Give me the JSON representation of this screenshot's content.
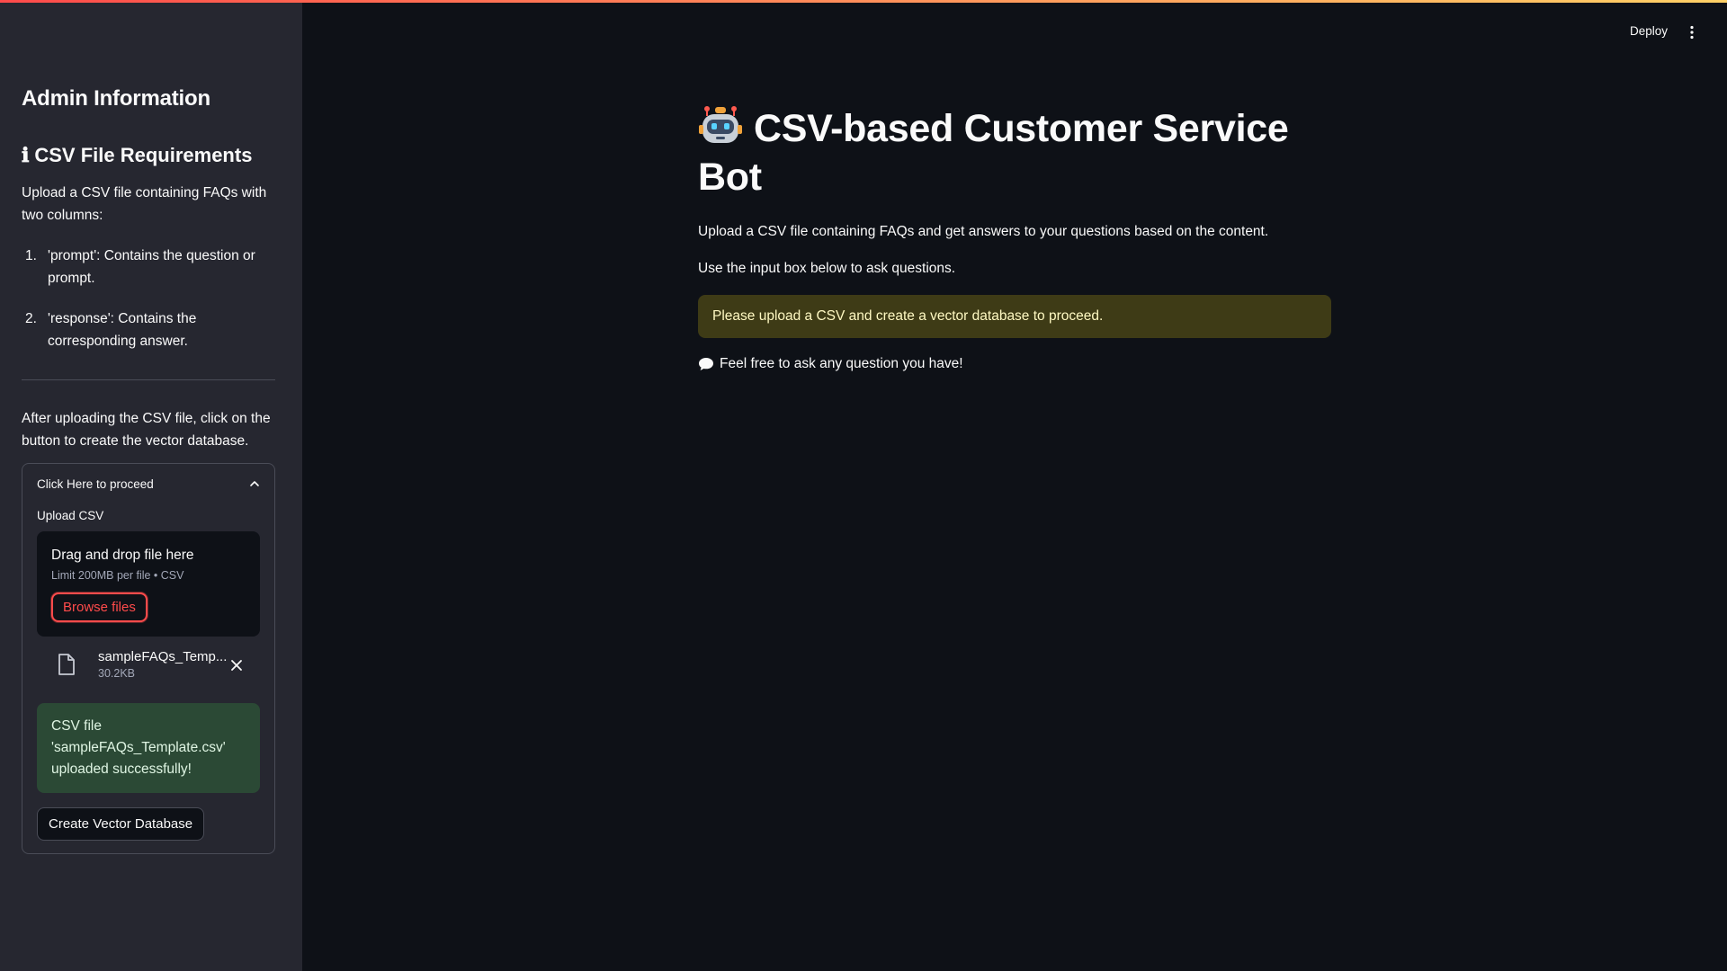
{
  "header": {
    "deploy_label": "Deploy",
    "menu_icon": "vertical-ellipsis-icon"
  },
  "sidebar": {
    "heading": "Admin Information",
    "req_icon_glyph": "ℹ",
    "req_heading": "CSV File Requirements",
    "req_intro": "Upload a CSV file containing FAQs with two columns:",
    "req_items": [
      {
        "num": "1.",
        "text": "'prompt': Contains the question or prompt."
      },
      {
        "num": "2.",
        "text": "'response': Contains the corresponding answer."
      }
    ],
    "after_upload_text": "After uploading the CSV file, click on the button to create the vector database.",
    "expander": {
      "label": "Click Here to proceed",
      "upload_label": "Upload CSV",
      "dropzone_title": "Drag and drop file here",
      "dropzone_sub": "Limit 200MB per file • CSV",
      "browse_label": "Browse files",
      "file": {
        "name": "sampleFAQs_Temp...",
        "size": "30.2KB"
      },
      "success_message": "CSV file 'sampleFAQs_Template.csv' uploaded successfully!",
      "create_button_label": "Create Vector Database"
    }
  },
  "main": {
    "title": "CSV-based Customer Service Bot",
    "title_icon": "robot-icon",
    "description": "Upload a CSV file containing FAQs and get answers to your questions based on the content.",
    "instruction": "Use the input box below to ask questions.",
    "warning": "Please upload a CSV and create a vector database to proceed.",
    "chat_hint": "Feel free to ask any question you have!",
    "chat_hint_icon": "speech-bubble-icon"
  },
  "colors": {
    "background": "#0e1117",
    "sidebar": "#262730",
    "accent": "#ff4b4b",
    "warning_bg": "#3e3b16",
    "success_bg": "#2b4935"
  }
}
